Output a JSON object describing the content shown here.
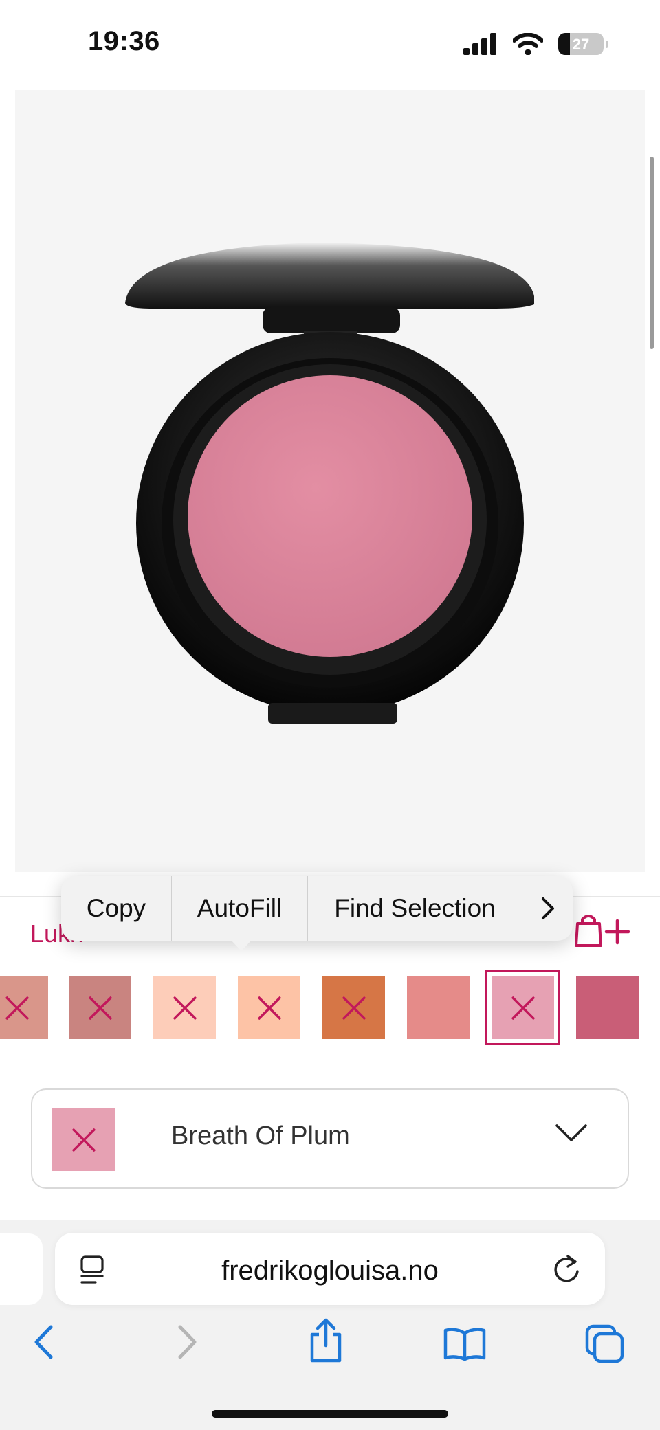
{
  "status_bar": {
    "time": "19:36",
    "battery": "27"
  },
  "product": {
    "image_alt": "blush compact"
  },
  "context_menu": {
    "copy": "Copy",
    "autofill": "AutoFill",
    "find_selection": "Find Selection",
    "more": "›"
  },
  "panel": {
    "close_label": "Lukk"
  },
  "swatches": [
    {
      "color": "#d9968a",
      "unavailable": true
    },
    {
      "color": "#c98480",
      "unavailable": true
    },
    {
      "color": "#fdcdb9",
      "unavailable": true
    },
    {
      "color": "#fdc3a6",
      "unavailable": true
    },
    {
      "color": "#d67646",
      "unavailable": true
    },
    {
      "color": "#e58b89",
      "unavailable": false
    },
    {
      "color": "#e6a1b3",
      "unavailable": true,
      "selected": true
    },
    {
      "color": "#c95e77",
      "unavailable": false
    }
  ],
  "shade_select": {
    "selected_name": "Breath Of Plum",
    "selected_color": "#e6a1b3"
  },
  "browser": {
    "url": "fredrikoglouisa.no"
  },
  "colors": {
    "accent": "#c2185b",
    "ios_blue": "#1e78d7"
  }
}
